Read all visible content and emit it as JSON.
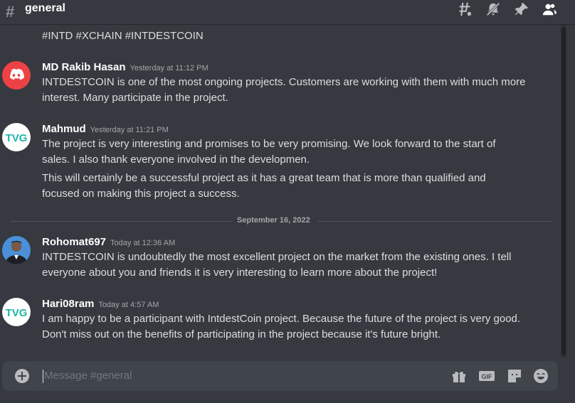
{
  "header": {
    "channel_name": "general",
    "icons": [
      "threads-icon",
      "mute-notifications-icon",
      "pin-icon",
      "member-list-icon"
    ]
  },
  "top_partial": {
    "text": "#INTD #XCHAIN  #INTDESTCOIN"
  },
  "messages": [
    {
      "username": "MD Rakib Hasan",
      "timestamp": "Yesterday at 11:12 PM",
      "avatar": "discord-logo-avatar",
      "lines": [
        "INTDESTCOIN is one of the most ongoing projects.  Customers are working with them with much more interest.  Many participate in the project."
      ]
    },
    {
      "username": "Mahmud",
      "timestamp": "Yesterday at 11:21 PM",
      "avatar": "tvg-logo-avatar",
      "lines": [
        "The project is very interesting and promises to be very promising. We look forward to the start of sales. I also thank everyone involved in the developmen.",
        "This will certainly be a successful project as it has a great team that is more than qualified and focused on making this project a success."
      ]
    },
    {
      "username": "Rohomat697",
      "timestamp": "Today at 12:36 AM",
      "avatar": "photo-avatar",
      "lines": [
        "INTDESTCOIN  is undoubtedly the most excellent project on the market from the existing ones. I tell everyone about you and friends it is very interesting to learn more about the project!"
      ]
    },
    {
      "username": "Hari08ram",
      "timestamp": "Today at 4:57 AM",
      "avatar": "tvg-logo-avatar",
      "lines": [
        "I am happy to be a participant with IntdestCoin project.  Because the future of the project is very good. Don't miss out on the benefits of participating in the project because it's future bright."
      ]
    }
  ],
  "date_divider": "September 16, 2022",
  "composer": {
    "placeholder": "Message #general",
    "icons": [
      "add-attachment-icon",
      "gift-icon",
      "gif-icon",
      "sticker-icon",
      "emoji-icon"
    ]
  },
  "colors": {
    "background": "#36393f",
    "composer": "#40444b",
    "discord_red": "#ed4245",
    "tvg_teal": "#1fb5a3"
  }
}
